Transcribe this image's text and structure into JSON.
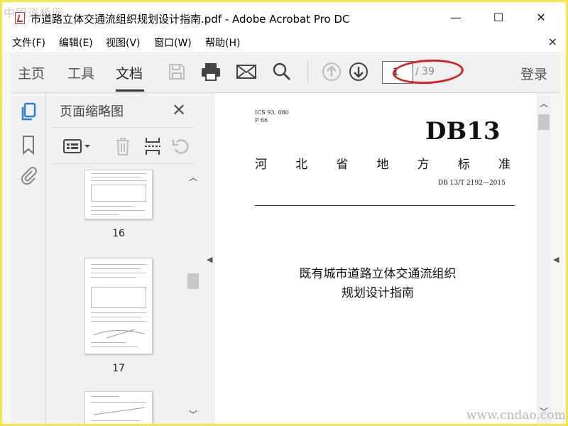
{
  "window": {
    "title": "市道路立体交通流组织规划设计指南.pdf - Adobe Acrobat Pro DC",
    "minimize": "—",
    "maximize": "☐",
    "close": "✕"
  },
  "watermark": {
    "top": "中国道桥网",
    "bottom": "www.cndao.com"
  },
  "menu": {
    "items": [
      "文件(F)",
      "编辑(E)",
      "视图(V)",
      "窗口(W)",
      "帮助(H)"
    ],
    "close": "×"
  },
  "toolbar": {
    "tabs": [
      "主页",
      "工具",
      "文档"
    ],
    "active_tab": "文档",
    "icons": [
      "save-icon",
      "print-icon",
      "email-icon",
      "search-icon",
      "arrow-up-icon",
      "arrow-down-icon"
    ],
    "page_current": "1",
    "page_total": "/ 39",
    "login": "登录"
  },
  "sidebar": {
    "icons": [
      "page-thumbnails-icon",
      "bookmark-icon",
      "attachment-icon"
    ]
  },
  "thumbnail_panel": {
    "title": "页面缩略图",
    "close": "✕",
    "tools": [
      "thumbnail-options-icon",
      "delete-icon",
      "insert-page-icon",
      "rotate-icon"
    ],
    "pages": [
      "16",
      "17"
    ]
  },
  "document": {
    "ics": "ICS  93. 080",
    "p": "P  66",
    "code": "DB13",
    "province_chars": [
      "河",
      "北",
      "省",
      "地",
      "方",
      "标",
      "准"
    ],
    "standard_number": "DB 13/T  2192—2015",
    "title_line1": "既有城市道路立体交通流组织",
    "title_line2": "规划设计指南"
  },
  "colors": {
    "accent_red": "#d82020",
    "frame_yellow": "#f2e64a",
    "icon_blue": "#2d7fd1"
  }
}
